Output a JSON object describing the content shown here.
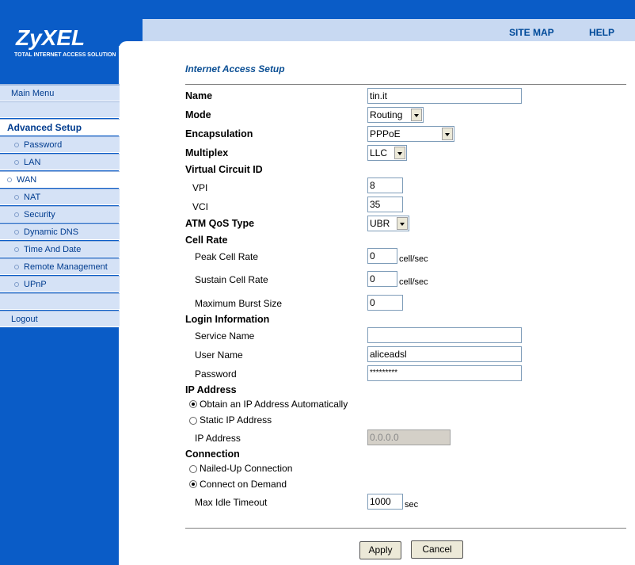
{
  "header": {
    "site_map": "SITE MAP",
    "help": "HELP",
    "logo": "ZyXEL",
    "logo_sub": "TOTAL INTERNET ACCESS SOLUTION"
  },
  "sidebar": {
    "main_menu": "Main Menu",
    "advanced_setup": "Advanced Setup",
    "items": [
      "Password",
      "LAN",
      "WAN",
      "NAT",
      "Security",
      "Dynamic DNS",
      "Time And Date",
      "Remote Management",
      "UPnP"
    ],
    "logout": "Logout"
  },
  "page": {
    "title": "Internet Access Setup",
    "name_label": "Name",
    "name_value": "tin.it",
    "mode_label": "Mode",
    "mode_value": "Routing",
    "encap_label": "Encapsulation",
    "encap_value": "PPPoE",
    "multiplex_label": "Multiplex",
    "multiplex_value": "LLC",
    "vc_label": "Virtual Circuit ID",
    "vpi_label": "VPI",
    "vpi_value": "8",
    "vci_label": "VCI",
    "vci_value": "35",
    "atm_label": "ATM QoS Type",
    "atm_value": "UBR",
    "cellrate_label": "Cell Rate",
    "pcr_label": "Peak Cell Rate",
    "pcr_value": "0",
    "scr_label": "Sustain Cell Rate",
    "scr_value": "0",
    "cell_unit": "cell/sec",
    "mbs_label": "Maximum Burst Size",
    "mbs_value": "0",
    "login_label": "Login Information",
    "service_label": "Service Name",
    "service_value": "",
    "user_label": "User Name",
    "user_value": "aliceadsl",
    "pass_label": "Password",
    "pass_value": "*********",
    "ip_label": "IP Address",
    "obtain_label": "Obtain an IP Address Automatically",
    "static_label": "Static IP Address",
    "ipaddr_label": "IP Address",
    "ipaddr_value": "0.0.0.0",
    "conn_label": "Connection",
    "nailed_label": "Nailed-Up Connection",
    "demand_label": "Connect on Demand",
    "idle_label": "Max Idle Timeout",
    "idle_value": "1000",
    "idle_unit": "sec",
    "apply": "Apply",
    "cancel": "Cancel"
  }
}
